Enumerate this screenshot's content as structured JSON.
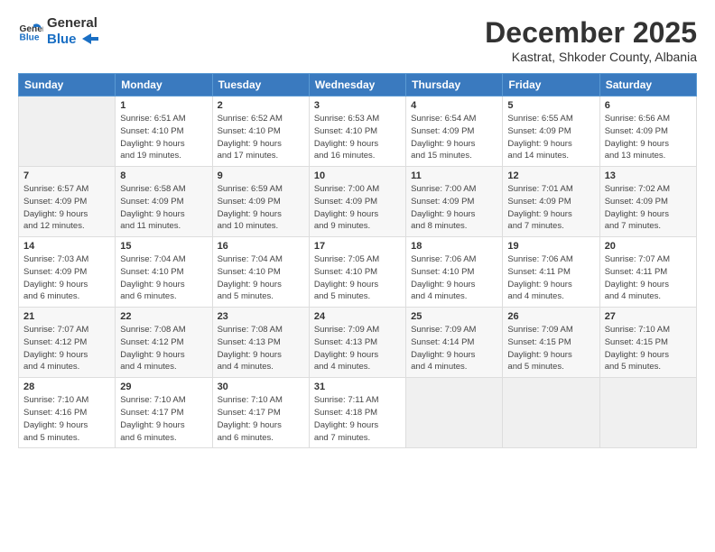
{
  "logo": {
    "general": "General",
    "blue": "Blue"
  },
  "header": {
    "month": "December 2025",
    "location": "Kastrat, Shkoder County, Albania"
  },
  "weekdays": [
    "Sunday",
    "Monday",
    "Tuesday",
    "Wednesday",
    "Thursday",
    "Friday",
    "Saturday"
  ],
  "weeks": [
    [
      {
        "day": "",
        "info": ""
      },
      {
        "day": "1",
        "info": "Sunrise: 6:51 AM\nSunset: 4:10 PM\nDaylight: 9 hours\nand 19 minutes."
      },
      {
        "day": "2",
        "info": "Sunrise: 6:52 AM\nSunset: 4:10 PM\nDaylight: 9 hours\nand 17 minutes."
      },
      {
        "day": "3",
        "info": "Sunrise: 6:53 AM\nSunset: 4:10 PM\nDaylight: 9 hours\nand 16 minutes."
      },
      {
        "day": "4",
        "info": "Sunrise: 6:54 AM\nSunset: 4:09 PM\nDaylight: 9 hours\nand 15 minutes."
      },
      {
        "day": "5",
        "info": "Sunrise: 6:55 AM\nSunset: 4:09 PM\nDaylight: 9 hours\nand 14 minutes."
      },
      {
        "day": "6",
        "info": "Sunrise: 6:56 AM\nSunset: 4:09 PM\nDaylight: 9 hours\nand 13 minutes."
      }
    ],
    [
      {
        "day": "7",
        "info": "Sunrise: 6:57 AM\nSunset: 4:09 PM\nDaylight: 9 hours\nand 12 minutes."
      },
      {
        "day": "8",
        "info": "Sunrise: 6:58 AM\nSunset: 4:09 PM\nDaylight: 9 hours\nand 11 minutes."
      },
      {
        "day": "9",
        "info": "Sunrise: 6:59 AM\nSunset: 4:09 PM\nDaylight: 9 hours\nand 10 minutes."
      },
      {
        "day": "10",
        "info": "Sunrise: 7:00 AM\nSunset: 4:09 PM\nDaylight: 9 hours\nand 9 minutes."
      },
      {
        "day": "11",
        "info": "Sunrise: 7:00 AM\nSunset: 4:09 PM\nDaylight: 9 hours\nand 8 minutes."
      },
      {
        "day": "12",
        "info": "Sunrise: 7:01 AM\nSunset: 4:09 PM\nDaylight: 9 hours\nand 7 minutes."
      },
      {
        "day": "13",
        "info": "Sunrise: 7:02 AM\nSunset: 4:09 PM\nDaylight: 9 hours\nand 7 minutes."
      }
    ],
    [
      {
        "day": "14",
        "info": "Sunrise: 7:03 AM\nSunset: 4:09 PM\nDaylight: 9 hours\nand 6 minutes."
      },
      {
        "day": "15",
        "info": "Sunrise: 7:04 AM\nSunset: 4:10 PM\nDaylight: 9 hours\nand 6 minutes."
      },
      {
        "day": "16",
        "info": "Sunrise: 7:04 AM\nSunset: 4:10 PM\nDaylight: 9 hours\nand 5 minutes."
      },
      {
        "day": "17",
        "info": "Sunrise: 7:05 AM\nSunset: 4:10 PM\nDaylight: 9 hours\nand 5 minutes."
      },
      {
        "day": "18",
        "info": "Sunrise: 7:06 AM\nSunset: 4:10 PM\nDaylight: 9 hours\nand 4 minutes."
      },
      {
        "day": "19",
        "info": "Sunrise: 7:06 AM\nSunset: 4:11 PM\nDaylight: 9 hours\nand 4 minutes."
      },
      {
        "day": "20",
        "info": "Sunrise: 7:07 AM\nSunset: 4:11 PM\nDaylight: 9 hours\nand 4 minutes."
      }
    ],
    [
      {
        "day": "21",
        "info": "Sunrise: 7:07 AM\nSunset: 4:12 PM\nDaylight: 9 hours\nand 4 minutes."
      },
      {
        "day": "22",
        "info": "Sunrise: 7:08 AM\nSunset: 4:12 PM\nDaylight: 9 hours\nand 4 minutes."
      },
      {
        "day": "23",
        "info": "Sunrise: 7:08 AM\nSunset: 4:13 PM\nDaylight: 9 hours\nand 4 minutes."
      },
      {
        "day": "24",
        "info": "Sunrise: 7:09 AM\nSunset: 4:13 PM\nDaylight: 9 hours\nand 4 minutes."
      },
      {
        "day": "25",
        "info": "Sunrise: 7:09 AM\nSunset: 4:14 PM\nDaylight: 9 hours\nand 4 minutes."
      },
      {
        "day": "26",
        "info": "Sunrise: 7:09 AM\nSunset: 4:15 PM\nDaylight: 9 hours\nand 5 minutes."
      },
      {
        "day": "27",
        "info": "Sunrise: 7:10 AM\nSunset: 4:15 PM\nDaylight: 9 hours\nand 5 minutes."
      }
    ],
    [
      {
        "day": "28",
        "info": "Sunrise: 7:10 AM\nSunset: 4:16 PM\nDaylight: 9 hours\nand 5 minutes."
      },
      {
        "day": "29",
        "info": "Sunrise: 7:10 AM\nSunset: 4:17 PM\nDaylight: 9 hours\nand 6 minutes."
      },
      {
        "day": "30",
        "info": "Sunrise: 7:10 AM\nSunset: 4:17 PM\nDaylight: 9 hours\nand 6 minutes."
      },
      {
        "day": "31",
        "info": "Sunrise: 7:11 AM\nSunset: 4:18 PM\nDaylight: 9 hours\nand 7 minutes."
      },
      {
        "day": "",
        "info": ""
      },
      {
        "day": "",
        "info": ""
      },
      {
        "day": "",
        "info": ""
      }
    ]
  ]
}
